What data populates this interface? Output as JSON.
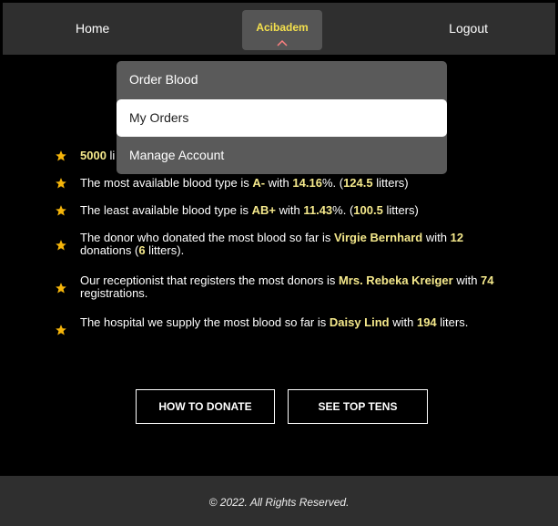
{
  "nav": {
    "home": "Home",
    "brand": "Acibadem",
    "logout": "Logout",
    "brand_color": "#f4e04d"
  },
  "dropdown": {
    "items": [
      {
        "label": "Order Blood",
        "active": false
      },
      {
        "label": "My Orders",
        "active": true
      },
      {
        "label": "Manage Account",
        "active": false
      }
    ]
  },
  "facts": [
    {
      "parts": [
        {
          "t": "5000",
          "h": true
        },
        {
          "t": " li",
          "h": false
        }
      ]
    },
    {
      "parts": [
        {
          "t": "The most available blood type is ",
          "h": false
        },
        {
          "t": "A-",
          "h": true
        },
        {
          "t": " with ",
          "h": false
        },
        {
          "t": "14.16",
          "h": true
        },
        {
          "t": "%. (",
          "h": false
        },
        {
          "t": "124.5",
          "h": true
        },
        {
          "t": " litters)",
          "h": false
        }
      ]
    },
    {
      "parts": [
        {
          "t": "The least available blood type is ",
          "h": false
        },
        {
          "t": "AB+",
          "h": true
        },
        {
          "t": " with ",
          "h": false
        },
        {
          "t": "11.43",
          "h": true
        },
        {
          "t": "%. (",
          "h": false
        },
        {
          "t": "100.5",
          "h": true
        },
        {
          "t": " litters)",
          "h": false
        }
      ]
    },
    {
      "parts": [
        {
          "t": "The donor who donated the most blood so far is ",
          "h": false
        },
        {
          "t": "Virgie Bernhard",
          "h": true
        },
        {
          "t": " with ",
          "h": false
        },
        {
          "t": "12",
          "h": true
        },
        {
          "t": " donations (",
          "h": false
        },
        {
          "t": "6",
          "h": true
        },
        {
          "t": " litters).",
          "h": false
        }
      ]
    },
    {
      "parts": [
        {
          "t": "Our receptionist that registers the most donors is ",
          "h": false
        },
        {
          "t": "Mrs. Rebeka Kreiger",
          "h": true
        },
        {
          "t": " with ",
          "h": false
        },
        {
          "t": "74",
          "h": true
        },
        {
          "t": " registrations.",
          "h": false
        }
      ]
    },
    {
      "parts": [
        {
          "t": "The hospital we supply the most blood so far is ",
          "h": false
        },
        {
          "t": "Daisy Lind",
          "h": true
        },
        {
          "t": " with ",
          "h": false
        },
        {
          "t": "194",
          "h": true
        },
        {
          "t": " liters.",
          "h": false
        }
      ]
    }
  ],
  "buttons": {
    "how_to_donate": "HOW TO DONATE",
    "see_top_tens": "SEE TOP TENS"
  },
  "footer": {
    "text": "© 2022. All Rights Reserved."
  },
  "colors": {
    "highlight": "#f4e88b",
    "star": "#f5b50a",
    "bar": "#2f2f2f"
  }
}
